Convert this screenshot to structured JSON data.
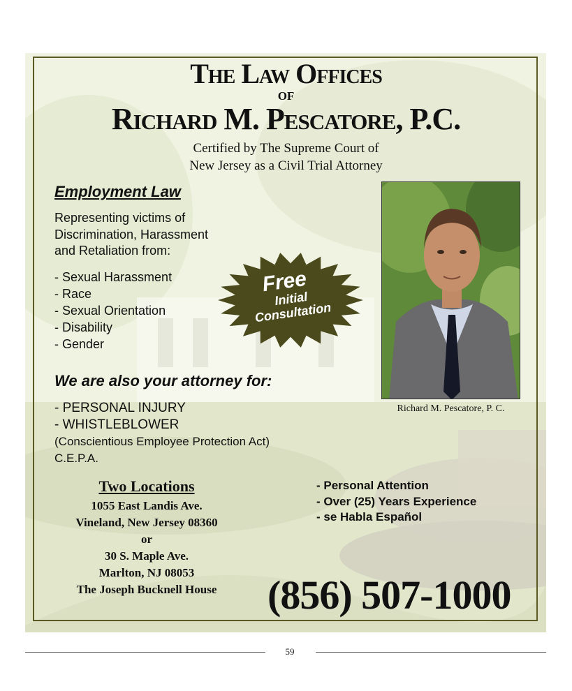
{
  "header": {
    "title_line1": "The Law Offices",
    "title_of": "OF",
    "title_line2": "Richard M. Pescatore, P.C.",
    "cert_line1": "Certified by The Supreme Court of",
    "cert_line2": "New Jersey as a Civil Trial Attorney"
  },
  "employment": {
    "heading": "Employment Law",
    "intro_line1": "Representing victims of",
    "intro_line2": "Discrimination, Harassment",
    "intro_line3": "and Retaliation from:",
    "items": [
      "- Sexual Harassment",
      "- Race",
      "- Sexual Orientation",
      "- Disability",
      "- Gender"
    ]
  },
  "badge": {
    "line1": "Free",
    "line2": "Initial",
    "line3": "Consultation",
    "color": "#4a4a1c"
  },
  "also": {
    "heading": "We are also your attorney for:",
    "items": [
      "- PERSONAL INJURY",
      "- WHISTLEBLOWER",
      "(Conscientious Employee Protection Act)",
      "C.E.P.A."
    ]
  },
  "photo": {
    "icon": "attorney-portrait",
    "caption": "Richard M. Pescatore, P. C."
  },
  "locations": {
    "heading": "Two Locations",
    "lines": [
      "1055 East Landis Ave.",
      "Vineland, New Jersey 08360",
      "or",
      "30 S. Maple Ave.",
      "Marlton, NJ 08053",
      "The Joseph Bucknell House"
    ]
  },
  "features": [
    "- Personal Attention",
    "- Over (25) Years Experience",
    "- se Habla Español"
  ],
  "phone": "(856) 507-1000",
  "page_number": "59",
  "colors": {
    "frame": "#5a5a22",
    "background": "#f3f4e4"
  }
}
